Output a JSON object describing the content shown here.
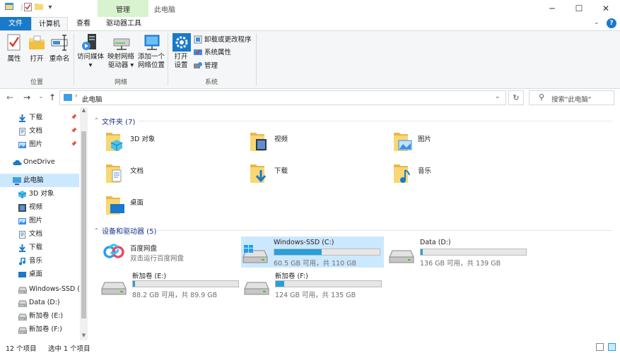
{
  "window": {
    "title": "此电脑",
    "context_tab_group": "管理",
    "controls": {
      "minimize": "─",
      "maximize": "☐",
      "close": "✕"
    }
  },
  "quick_access_toolbar": {
    "dropdown": "▾"
  },
  "ribbon_tabs": {
    "file": "文件",
    "computer": "计算机",
    "view": "查看",
    "drive_tools": "驱动器工具",
    "collapse": "⌄",
    "help": "?"
  },
  "ribbon": {
    "location_group": {
      "label": "位置",
      "properties": "属性",
      "open": "打开",
      "rename": "重命名"
    },
    "network_group": {
      "label": "网络",
      "access_media": [
        "访问媒体",
        "▾"
      ],
      "map_drive": [
        "映射网络",
        "驱动器 ▾"
      ],
      "add_location": [
        "添加一个",
        "网络位置"
      ]
    },
    "system_group": {
      "label": "系统",
      "open_settings": [
        "打开",
        "设置"
      ],
      "uninstall": "卸载或更改程序",
      "system_properties": "系统属性",
      "manage": "管理"
    }
  },
  "address_bar": {
    "back": "←",
    "forward": "→",
    "recent": "⌄",
    "up": "↑",
    "separator": "›",
    "path": "此电脑",
    "dropdown": "⌄",
    "refresh": "↻",
    "search_placeholder": "搜索\"此电脑\"",
    "search_icon_glyph": "⚲"
  },
  "nav_pane": {
    "scroll_up": "▲",
    "scroll_down": "▼",
    "pin_glyph": "📌",
    "items": [
      {
        "label": "下载",
        "icon": "download-icon",
        "pinned": true
      },
      {
        "label": "文档",
        "icon": "document-icon",
        "pinned": true
      },
      {
        "label": "图片",
        "icon": "picture-icon",
        "pinned": true
      },
      {
        "label": "OneDrive",
        "icon": "cloud-icon"
      },
      {
        "label": "此电脑",
        "icon": "pc-icon",
        "selected": true
      },
      {
        "label": "3D 对象",
        "icon": "3d-object-icon"
      },
      {
        "label": "视频",
        "icon": "video-icon"
      },
      {
        "label": "图片",
        "icon": "picture-icon"
      },
      {
        "label": "文档",
        "icon": "document-icon"
      },
      {
        "label": "下载",
        "icon": "download-icon"
      },
      {
        "label": "音乐",
        "icon": "music-icon"
      },
      {
        "label": "桌面",
        "icon": "desktop-icon"
      },
      {
        "label": "Windows-SSD (",
        "icon": "drive-icon"
      },
      {
        "label": "Data (D:)",
        "icon": "drive-icon"
      },
      {
        "label": "新加卷 (E:)",
        "icon": "drive-icon"
      },
      {
        "label": "新加卷 (F:)",
        "icon": "drive-icon"
      }
    ]
  },
  "content": {
    "folders_section": {
      "title": "文件夹 (7)",
      "chevron": "⌃"
    },
    "folders": [
      {
        "name": "3D 对象",
        "icon": "3d-object-icon"
      },
      {
        "name": "视频",
        "icon": "video-icon"
      },
      {
        "name": "图片",
        "icon": "picture-icon"
      },
      {
        "name": "文档",
        "icon": "document-icon"
      },
      {
        "name": "下载",
        "icon": "download-icon"
      },
      {
        "name": "音乐",
        "icon": "music-icon"
      },
      {
        "name": "桌面",
        "icon": "desktop-icon"
      }
    ],
    "drives_section": {
      "title": "设备和驱动器 (5)",
      "chevron": "⌃"
    },
    "baidu": {
      "name": "百度网盘",
      "desc": "双击运行百度网盘"
    },
    "drives": [
      {
        "name": "Windows-SSD (C:)",
        "free": "60.5 GB 可用，共 110 GB",
        "used_fraction": 0.45,
        "selected": true
      },
      {
        "name": "Data (D:)",
        "free": "136 GB 可用，共 139 GB",
        "used_fraction": 0.02
      },
      {
        "name": "新加卷 (E:)",
        "free": "88.2 GB 可用，共 89.9 GB",
        "used_fraction": 0.02
      },
      {
        "name": "新加卷 (F:)",
        "free": "124 GB 可用，共 135 GB",
        "used_fraction": 0.08
      }
    ]
  },
  "status_bar": {
    "item_count": "12 个项目",
    "selected_count": "选中 1 个项目"
  },
  "colors": {
    "accent": "#1979ca",
    "selection": "#cce8ff",
    "drive_fill": "#26a0da",
    "folder_yellow": "#f8d775"
  }
}
